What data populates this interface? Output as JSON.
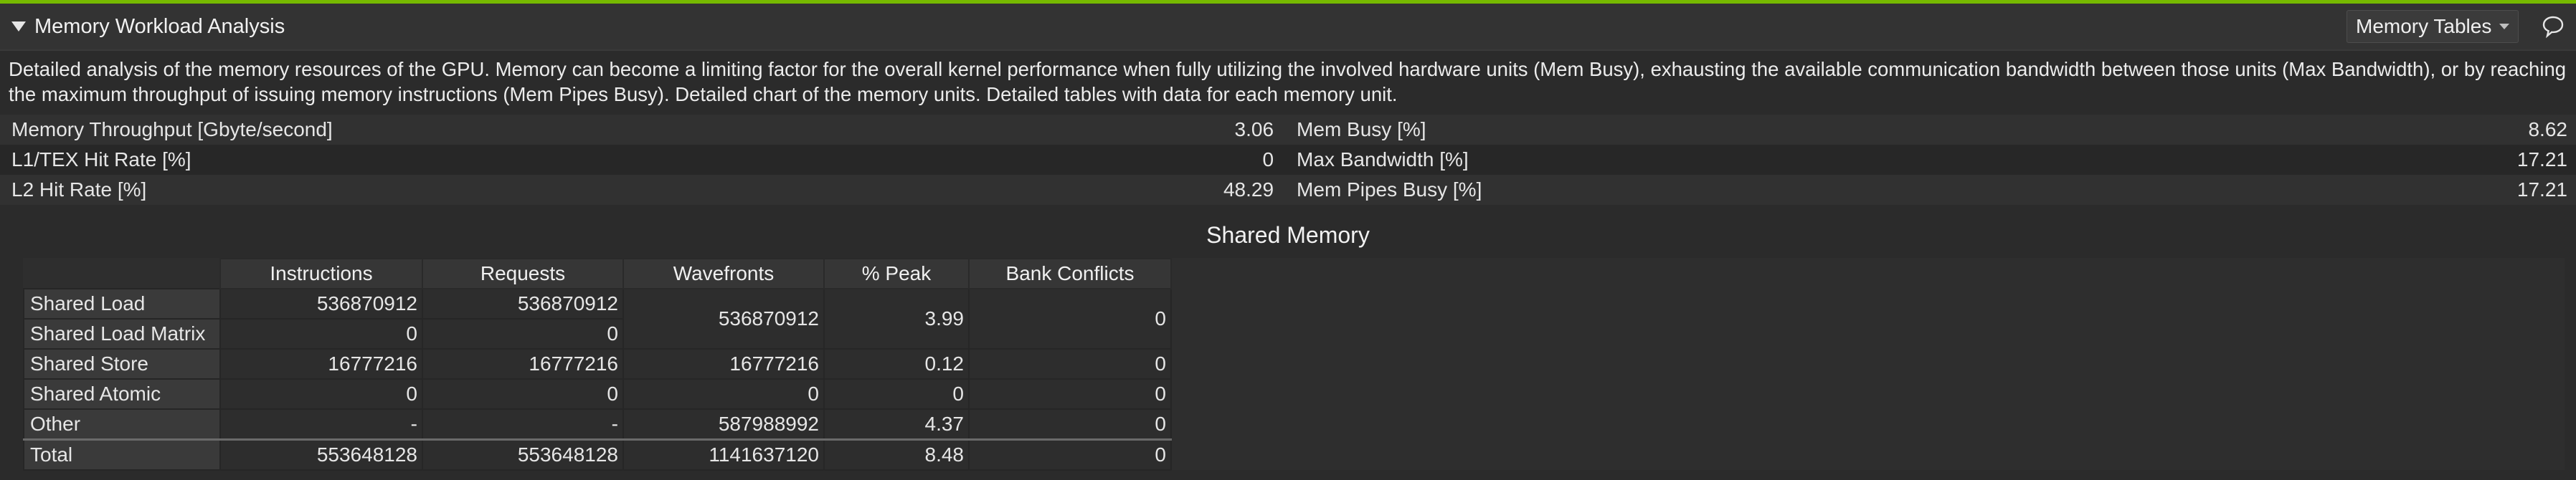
{
  "section": {
    "title": "Memory Workload Analysis",
    "view_selector": "Memory Tables",
    "description": "Detailed analysis of the memory resources of the GPU. Memory can become a limiting factor for the overall kernel performance when fully utilizing the involved hardware units (Mem Busy), exhausting the available communication bandwidth between those units (Max Bandwidth), or by reaching the maximum throughput of issuing memory instructions (Mem Pipes Busy). Detailed chart of the memory units. Detailed tables with data for each memory unit."
  },
  "metrics": [
    {
      "left_label": "Memory Throughput [Gbyte/second]",
      "left_value": "3.06",
      "right_label": "Mem Busy [%]",
      "right_value": "8.62"
    },
    {
      "left_label": "L1/TEX Hit Rate [%]",
      "left_value": "0",
      "right_label": "Max Bandwidth [%]",
      "right_value": "17.21"
    },
    {
      "left_label": "L2 Hit Rate [%]",
      "left_value": "48.29",
      "right_label": "Mem Pipes Busy [%]",
      "right_value": "17.21"
    }
  ],
  "shared_memory": {
    "title": "Shared Memory",
    "columns": [
      "Instructions",
      "Requests",
      "Wavefronts",
      "% Peak",
      "Bank Conflicts"
    ],
    "rows": [
      {
        "name": "Shared Load",
        "instructions": "536870912",
        "requests": "536870912"
      },
      {
        "name": "Shared Load Matrix",
        "instructions": "0",
        "requests": "0"
      },
      {
        "name": "Shared Store",
        "instructions": "16777216",
        "requests": "16777216",
        "wavefronts": "16777216",
        "peak": "0.12",
        "bank_conflicts": "0"
      },
      {
        "name": "Shared Atomic",
        "instructions": "0",
        "requests": "0",
        "wavefronts": "0",
        "peak": "0",
        "bank_conflicts": "0"
      },
      {
        "name": "Other",
        "instructions": "-",
        "requests": "-",
        "wavefronts": "587988992",
        "peak": "4.37",
        "bank_conflicts": "0"
      },
      {
        "name": "Total",
        "instructions": "553648128",
        "requests": "553648128",
        "wavefronts": "1141637120",
        "peak": "8.48",
        "bank_conflicts": "0"
      }
    ],
    "merged_load": {
      "wavefronts": "536870912",
      "peak": "3.99",
      "bank_conflicts": "0"
    }
  },
  "colors": {
    "accent": "#76b900",
    "background": "#2b2b2b"
  },
  "icons": {
    "collapse": "triangle-down-icon",
    "comment": "speech-bubble-icon"
  }
}
